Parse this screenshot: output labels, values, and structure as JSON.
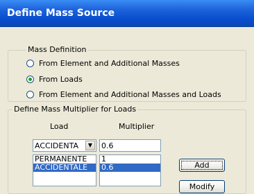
{
  "window": {
    "title": "Define Mass Source"
  },
  "mass_definition": {
    "legend": "Mass Definition",
    "options": [
      {
        "label": "From Element and Additional Masses",
        "checked": false
      },
      {
        "label": "From Loads",
        "checked": true
      },
      {
        "label": "From Element and Additional Masses and Loads",
        "checked": false
      }
    ]
  },
  "multiplier_group": {
    "legend": "Define Mass Multiplier for Loads",
    "load_header": "Load",
    "multiplier_header": "Multiplier",
    "load_combo_value": "ACCIDENTA",
    "multiplier_value": "0.6",
    "load_list": [
      "PERMANENTE",
      "ACCIDENTALE"
    ],
    "multiplier_list": [
      "1",
      "0.6"
    ],
    "selected_index": 1,
    "add_label": "Add",
    "modify_label": "Modify"
  }
}
